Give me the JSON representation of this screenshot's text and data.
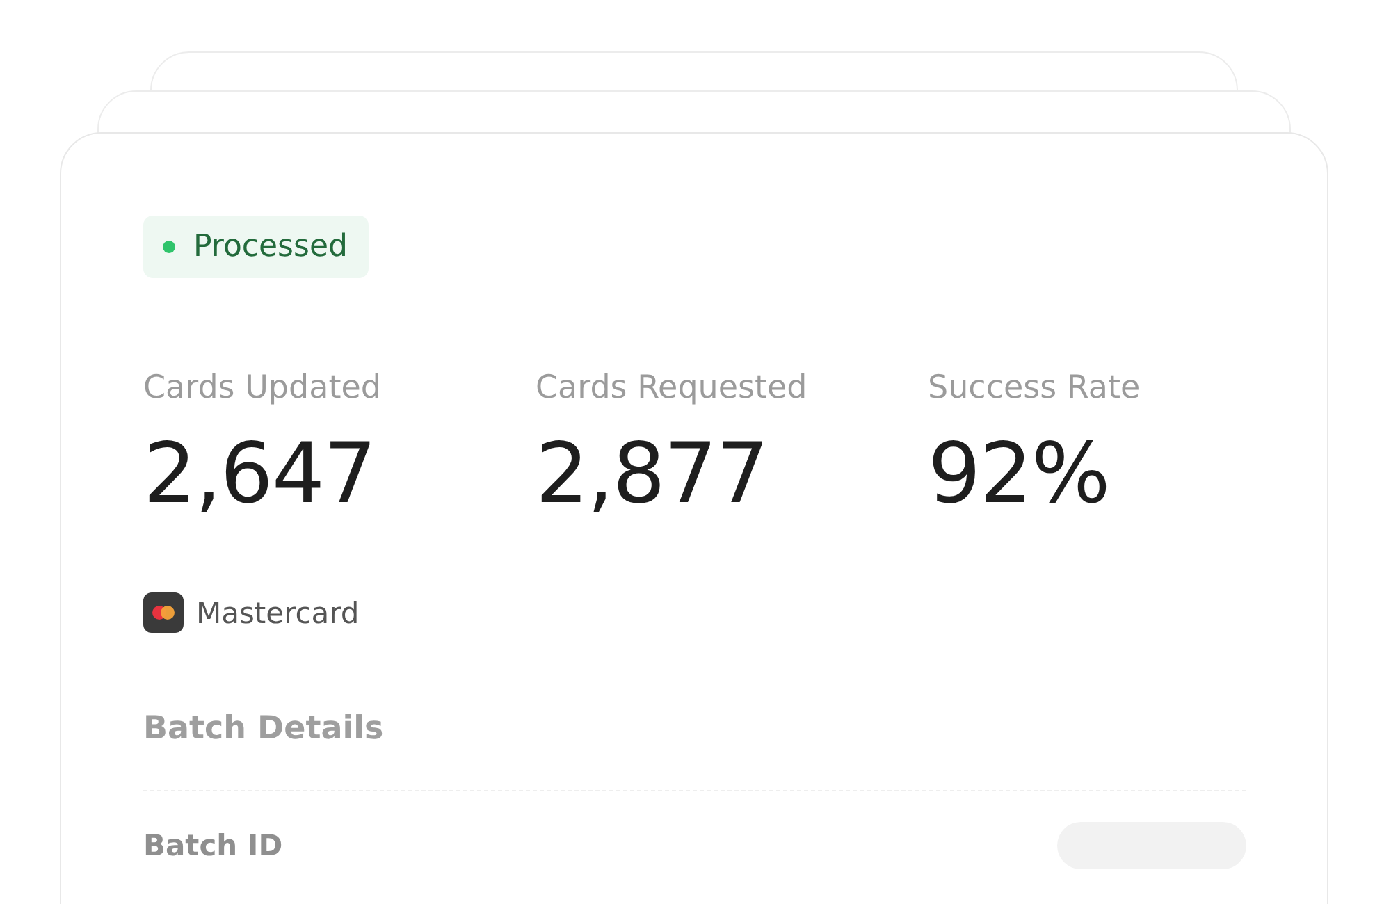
{
  "status": {
    "label": "Processed",
    "color": "#2fc46b"
  },
  "stats": [
    {
      "label": "Cards Updated",
      "value": "2,647"
    },
    {
      "label": "Cards Requested",
      "value": "2,877"
    },
    {
      "label": "Success Rate",
      "value": "92%"
    }
  ],
  "network": {
    "name": "Mastercard"
  },
  "section": {
    "title": "Batch Details"
  },
  "rows": [
    {
      "label": "Batch ID"
    }
  ]
}
